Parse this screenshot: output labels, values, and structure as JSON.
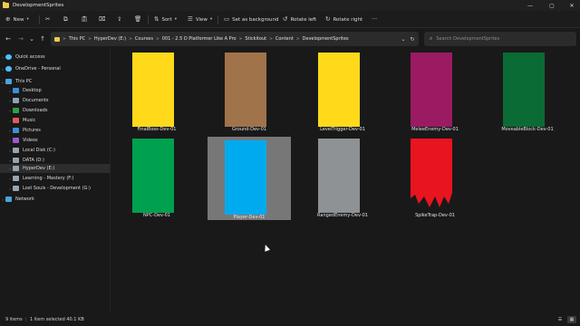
{
  "window": {
    "title": "DevelopmentSprites",
    "controls": {
      "minimize": "—",
      "maximize": "▢",
      "close": "✕"
    }
  },
  "toolbar": {
    "new_label": "New",
    "sort_label": "Sort",
    "view_label": "View",
    "set_background_label": "Set as background",
    "rotate_left_label": "Rotate left",
    "rotate_right_label": "Rotate right",
    "more_label": "···",
    "icons": [
      "cut-icon",
      "copy-icon",
      "paste-icon",
      "rename-icon",
      "share-icon",
      "delete-icon"
    ]
  },
  "address": {
    "breadcrumbs": [
      "This PC",
      "HyperDev (E:)",
      "Courses",
      "001 - 2.5 D Platformer Like A Pro",
      "Stickitout",
      "Content",
      "DevelopmentSprites"
    ],
    "crumb_separator": ">"
  },
  "search": {
    "placeholder": "Search DevelopmentSprites"
  },
  "sidebar": {
    "items": [
      {
        "label": "Quick access",
        "icon": "star-icon",
        "color": "#4cc2ff"
      },
      {
        "label": "OneDrive - Personal",
        "icon": "cloud-icon",
        "color": "#4cc2ff"
      },
      {
        "label": "This PC",
        "icon": "computer-icon",
        "color": "#4aa3df"
      },
      {
        "label": "Desktop",
        "icon": "desktop-icon",
        "color": "#3b8fd9"
      },
      {
        "label": "Documents",
        "icon": "documents-icon",
        "color": "#8fa3b8"
      },
      {
        "label": "Downloads",
        "icon": "downloads-icon",
        "color": "#2ea043"
      },
      {
        "label": "Music",
        "icon": "music-icon",
        "color": "#e05a5a"
      },
      {
        "label": "Pictures",
        "icon": "pictures-icon",
        "color": "#3b8fd9"
      },
      {
        "label": "Videos",
        "icon": "videos-icon",
        "color": "#9b59d0"
      },
      {
        "label": "Local Disk (C:)",
        "icon": "drive-icon",
        "color": "#9aa4ad"
      },
      {
        "label": "DATA (D:)",
        "icon": "drive-icon",
        "color": "#9aa4ad"
      },
      {
        "label": "HyperDev (E:)",
        "icon": "drive-icon",
        "color": "#9aa4ad"
      },
      {
        "label": "Learning - Mastery (F:)",
        "icon": "drive-icon",
        "color": "#9aa4ad"
      },
      {
        "label": "Lost Souls - Development (G:)",
        "icon": "drive-icon",
        "color": "#9aa4ad"
      },
      {
        "label": "Network",
        "icon": "network-icon",
        "color": "#4aa3df"
      }
    ]
  },
  "files": [
    {
      "name": "FinalBoss-Dev-01",
      "color": "#ffd91a",
      "shape": "rect"
    },
    {
      "name": "Ground-Dev-01",
      "color": "#a1734a",
      "shape": "rect"
    },
    {
      "name": "LevelTrigger-Dev-01",
      "color": "#ffd91a",
      "shape": "rect"
    },
    {
      "name": "MeleeEnemy-Dev-01",
      "color": "#9b1b63",
      "shape": "rect"
    },
    {
      "name": "MoveableBlock-Dev-01",
      "color": "#0a6b34",
      "shape": "rect"
    },
    {
      "name": "NPC-Dev-01",
      "color": "#00a14e",
      "shape": "rect"
    },
    {
      "name": "Player-Dev-01",
      "color": "#00aaee",
      "shape": "rect",
      "selected": true
    },
    {
      "name": "RangedEnemy-Dev-01",
      "color": "#8e9295",
      "shape": "rect"
    },
    {
      "name": "SpikeTrap-Dev-01",
      "color": "#e8141f",
      "shape": "spike"
    }
  ],
  "status": {
    "items_count": "9 items",
    "selection": "1 item selected  40.1 KB"
  }
}
